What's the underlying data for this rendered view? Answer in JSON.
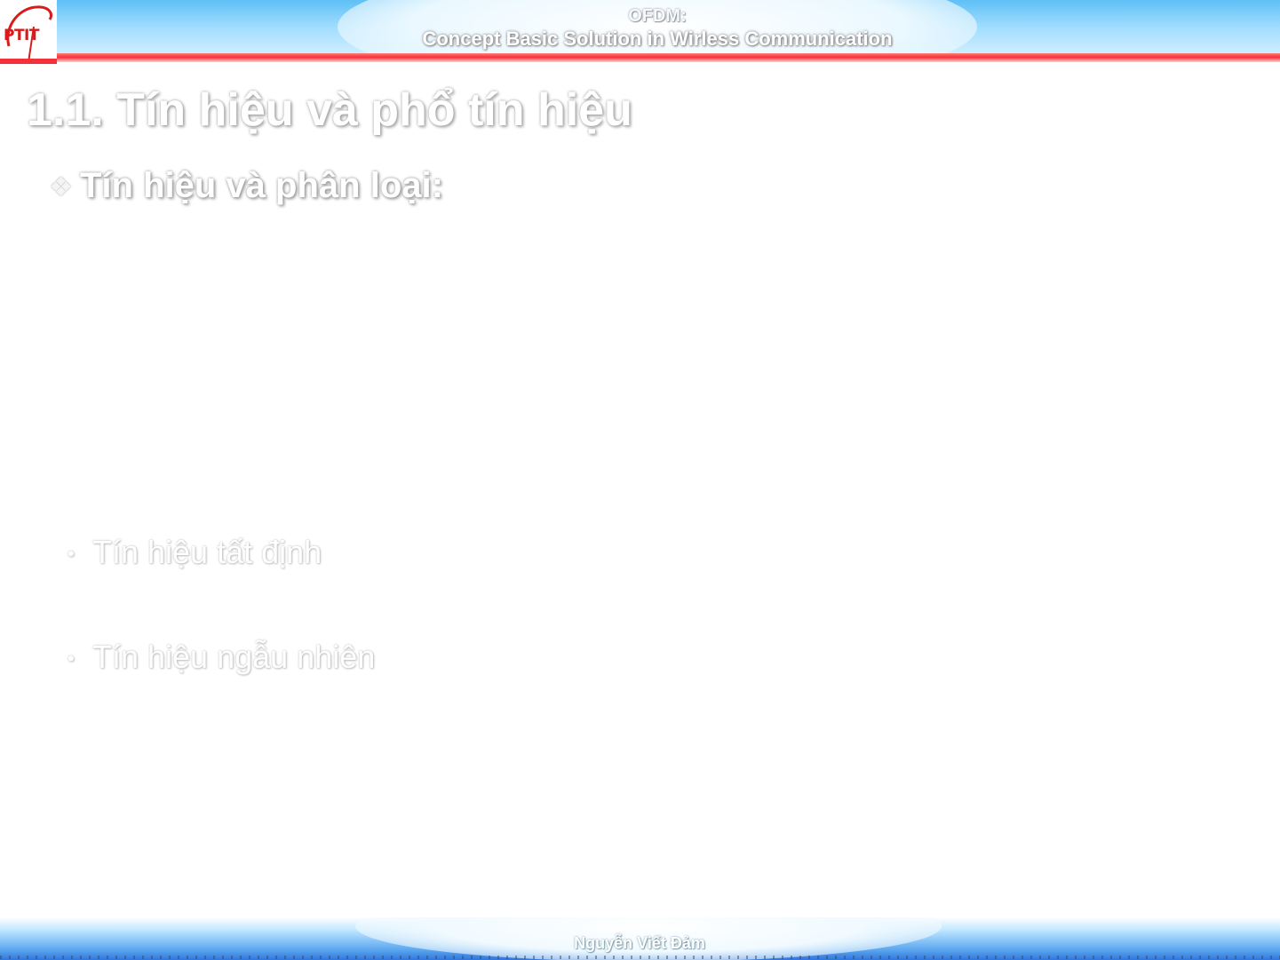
{
  "header": {
    "logo_text": "PTIT",
    "title_line1": "OFDM:",
    "title_line2": "Concept  Basic  Solution in Wirless Communication"
  },
  "content": {
    "title": "1.1. Tín hiệu và phổ tín hiệu",
    "subheading": "Tín hiệu và phân loại:",
    "items": [
      "Tín hiệu tất định",
      "Tín hiệu ngẫu nhiên"
    ]
  },
  "footer": {
    "author": "Nguyễn Viết Đảm"
  },
  "colors": {
    "header_top": "#5fc0f5",
    "header_rule": "#f4313a",
    "footer_bottom": "#2f76e0",
    "logo_red": "#d81b1b",
    "text_fill": "#ffffff",
    "text_shadow": "#9a9a9a"
  }
}
